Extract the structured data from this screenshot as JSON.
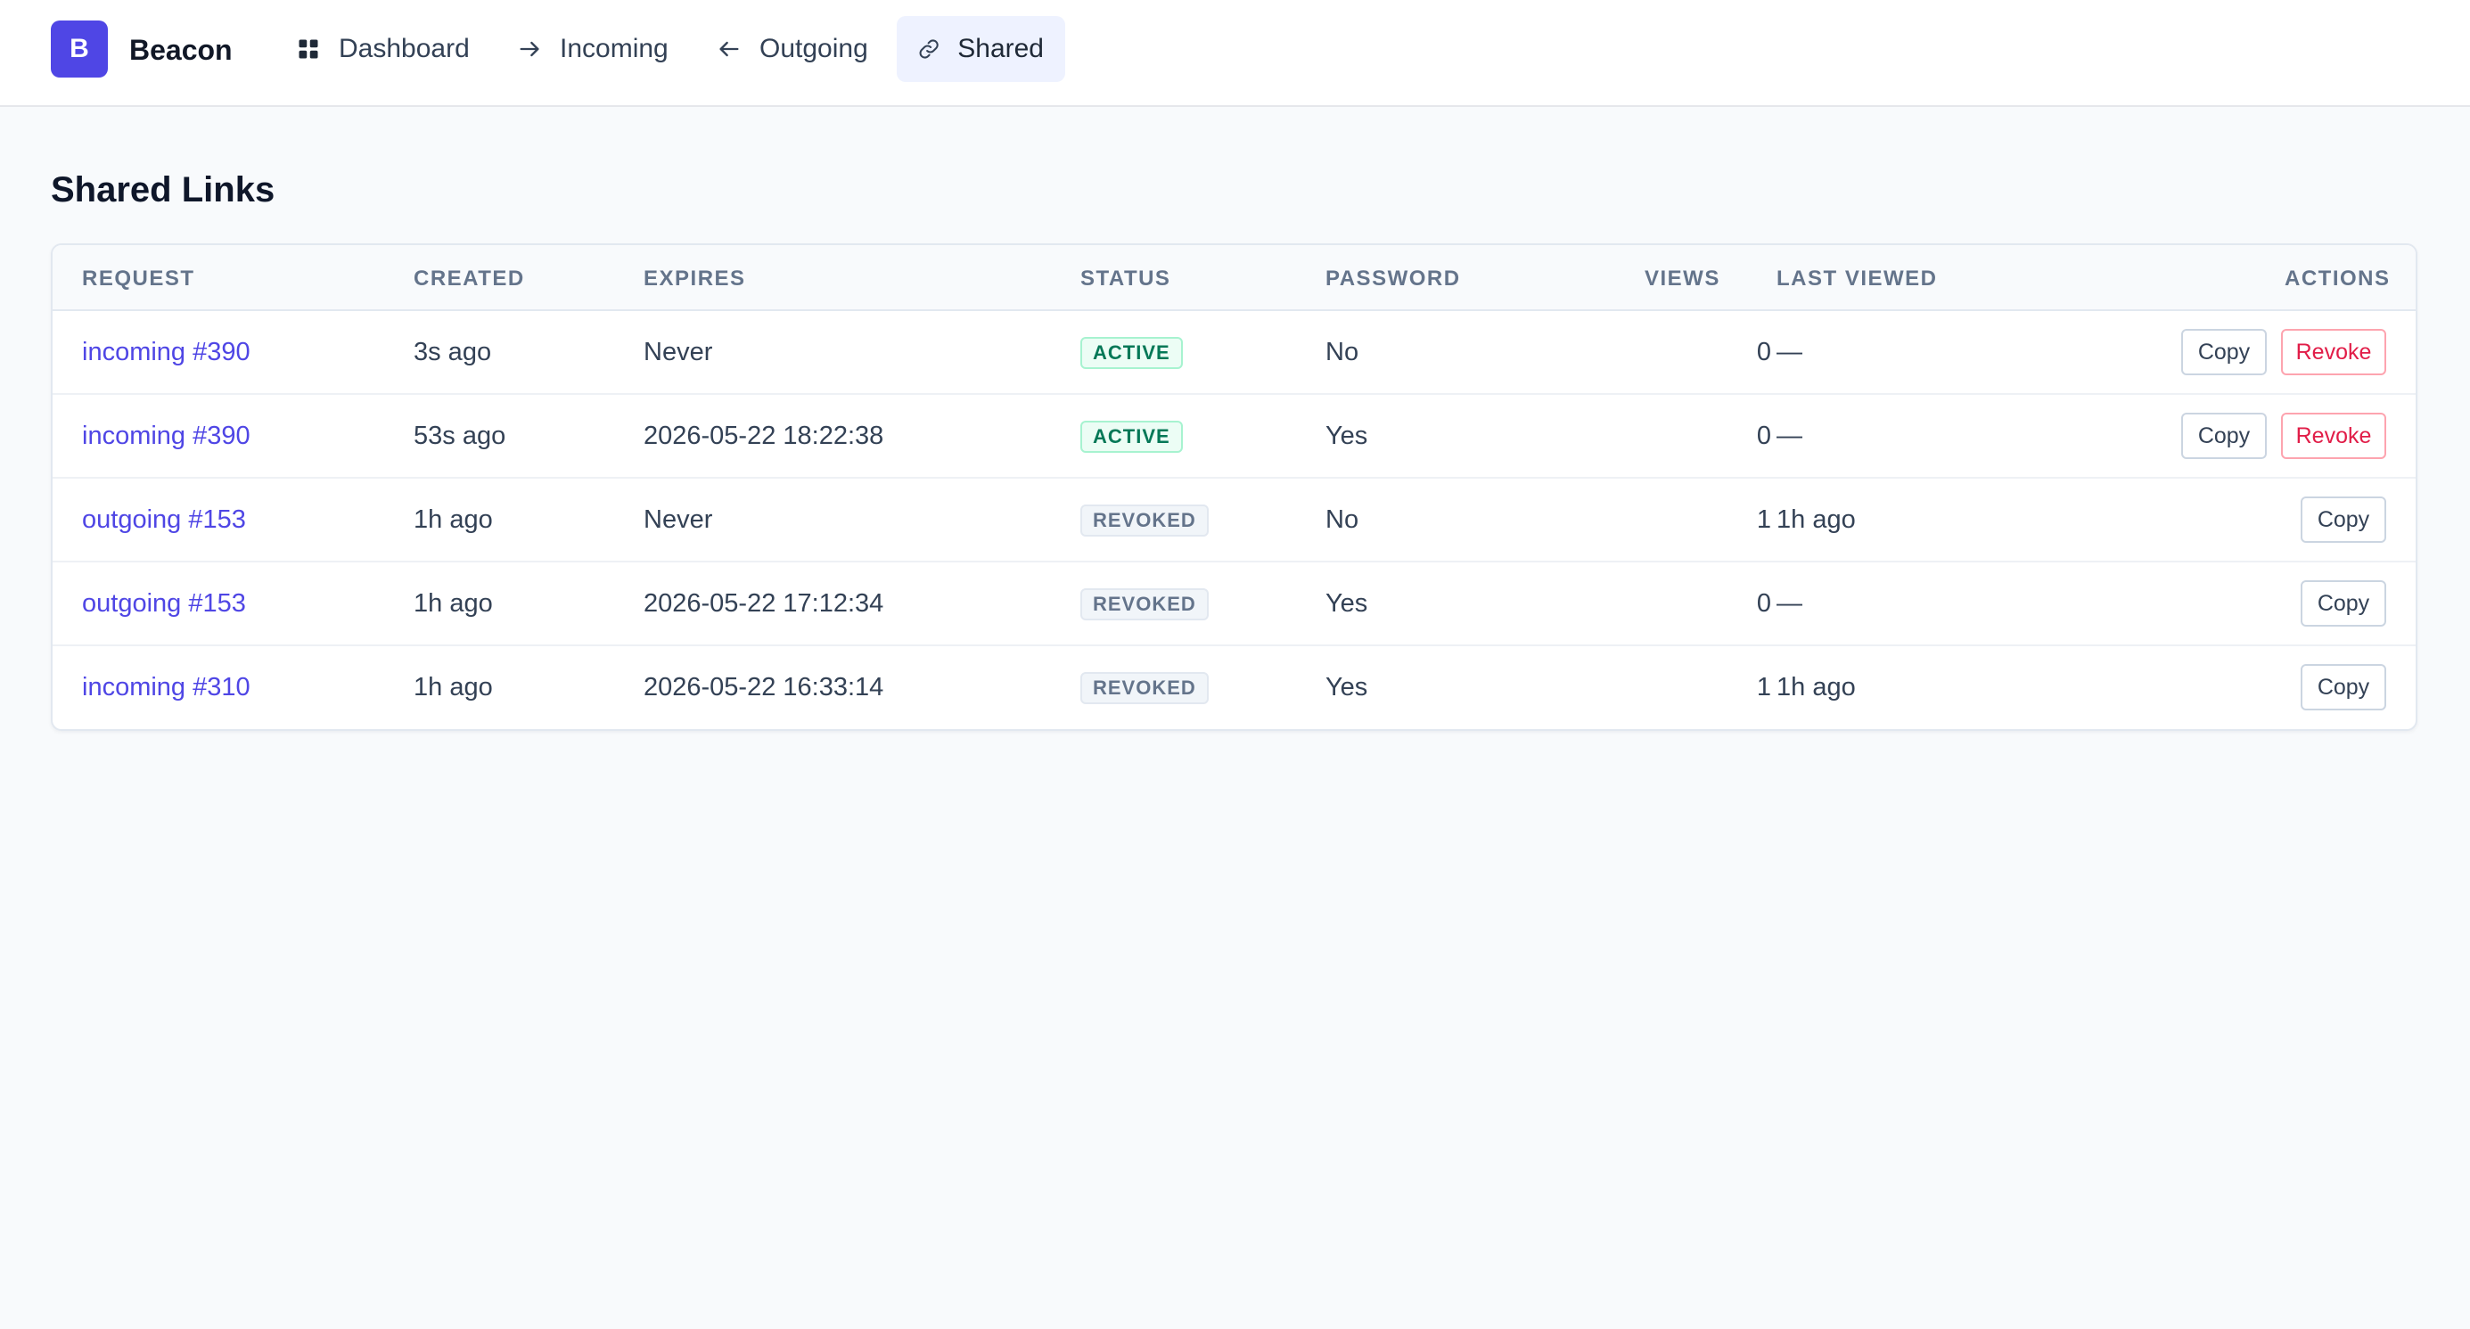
{
  "app": {
    "logo_letter": "B",
    "name": "Beacon"
  },
  "nav": [
    {
      "label": "Dashboard",
      "icon": "dashboard-grid-icon",
      "active": false
    },
    {
      "label": "Incoming",
      "icon": "arrow-right-icon",
      "active": false
    },
    {
      "label": "Outgoing",
      "icon": "arrow-left-icon",
      "active": false
    },
    {
      "label": "Shared",
      "icon": "link-icon",
      "active": true
    }
  ],
  "page": {
    "title": "Shared Links"
  },
  "table": {
    "columns": [
      "REQUEST",
      "CREATED",
      "EXPIRES",
      "STATUS",
      "PASSWORD",
      "VIEWS",
      "LAST VIEWED",
      "ACTIONS"
    ],
    "rows": [
      {
        "request": "incoming #390",
        "created": "3s ago",
        "expires": "Never",
        "status": "ACTIVE",
        "password": "No",
        "views": "0",
        "last_viewed": "—",
        "copy": "Copy",
        "revoke": "Revoke"
      },
      {
        "request": "incoming #390",
        "created": "53s ago",
        "expires": "2026-05-22 18:22:38",
        "status": "ACTIVE",
        "password": "Yes",
        "views": "0",
        "last_viewed": "—",
        "copy": "Copy",
        "revoke": "Revoke"
      },
      {
        "request": "outgoing #153",
        "created": "1h ago",
        "expires": "Never",
        "status": "REVOKED",
        "password": "No",
        "views": "1",
        "last_viewed": "1h ago",
        "copy": "Copy"
      },
      {
        "request": "outgoing #153",
        "created": "1h ago",
        "expires": "2026-05-22 17:12:34",
        "status": "REVOKED",
        "password": "Yes",
        "views": "0",
        "last_viewed": "—",
        "copy": "Copy"
      },
      {
        "request": "incoming #310",
        "created": "1h ago",
        "expires": "2026-05-22 16:33:14",
        "status": "REVOKED",
        "password": "Yes",
        "views": "1",
        "last_viewed": "1h ago",
        "copy": "Copy"
      }
    ]
  },
  "colors": {
    "accent": "#4f46e5",
    "active": "#047857",
    "revoke": "#e11d48"
  }
}
